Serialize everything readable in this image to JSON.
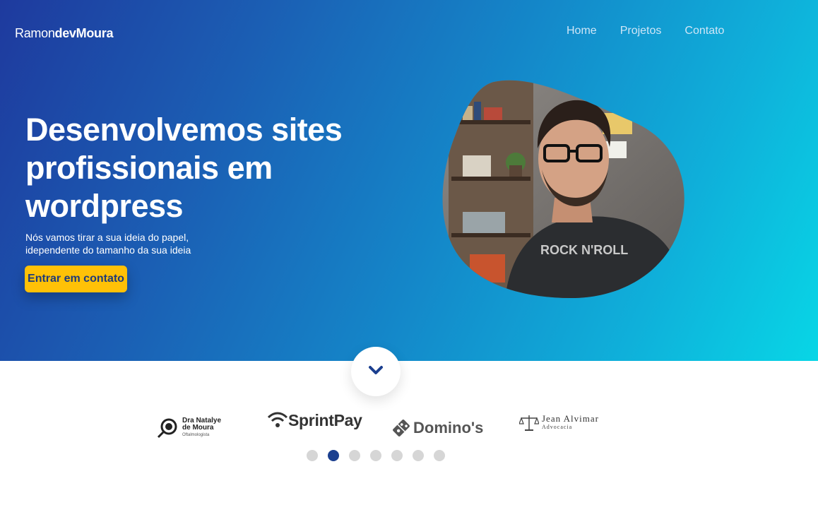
{
  "brand": {
    "part1": "Ramon",
    "part2": "dev",
    "part3": "Moura"
  },
  "nav": {
    "items": [
      "Home",
      "Projetos",
      "Contato"
    ]
  },
  "hero": {
    "headline": "Desenvolvemos sites profissionais em wordpress",
    "sub_line1": "Nós vamos tirar a sua ideia do papel,",
    "sub_line2": "idependente do tamanho da sua ideia",
    "cta_label": "Entrar em contato"
  },
  "clients": {
    "dra": {
      "line1": "Dra Natalye",
      "line2": "de Moura",
      "line3": "Oftalmologista"
    },
    "sprintpay": {
      "name": "SprintPay"
    },
    "dominos": {
      "name": "Domino's"
    },
    "jean": {
      "line1": "Jean Alvimar",
      "line2": "Advocacia"
    }
  },
  "carousel": {
    "total_dots": 7,
    "active_index": 1
  },
  "colors": {
    "accent": "#ffc107",
    "dot_active": "#1b3f8f",
    "dot_inactive": "#d6d6d6"
  },
  "icons": {
    "scroll": "chevron-down-icon"
  }
}
